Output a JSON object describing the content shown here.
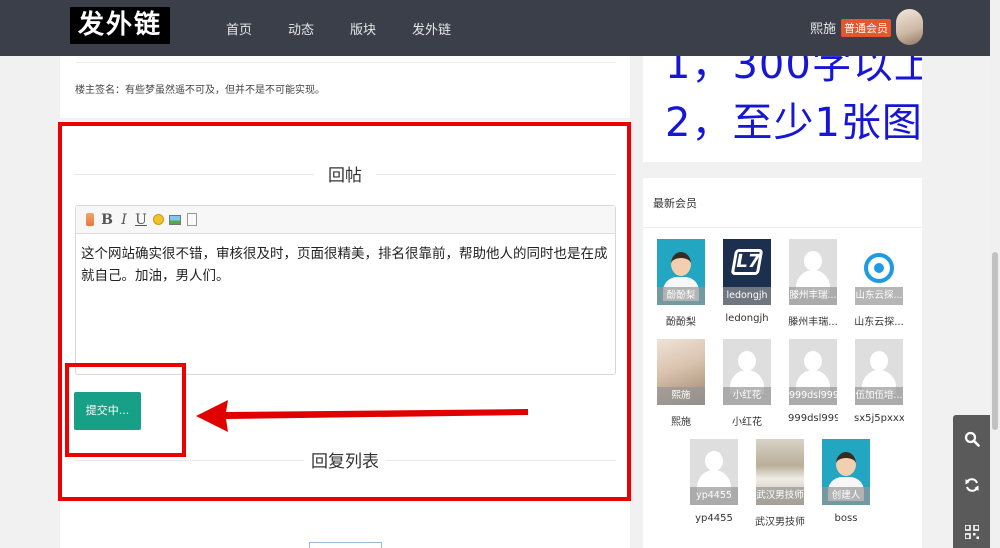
{
  "header": {
    "logo_text": "发外链",
    "nav": [
      "首页",
      "动态",
      "版块",
      "发外链"
    ],
    "user_name": "熙施",
    "vip_badge": "普通会员"
  },
  "post": {
    "signature": "楼主签名：有些梦虽然遥不可及，但并不是不可能实现。"
  },
  "reply": {
    "section_title": "回帖",
    "editor_text": "这个网站确实很不错，审核很及时，页面很精美，排名很靠前，帮助他人的同时也是在成就自己。加油，男人们。",
    "submit_label": "提交中...",
    "reply_list_title": "回复列表"
  },
  "rules": {
    "line1": "1，300字以上",
    "line2": "2，至少1张图"
  },
  "members": {
    "title": "最新会员",
    "items": [
      {
        "overlay": "酚酚梨",
        "name": "酚酚梨",
        "avatar": "male-avatar"
      },
      {
        "overlay": "ledongjh",
        "name": "ledongjh",
        "avatar": "logo-avatar"
      },
      {
        "overlay": "滕州丰瑞...",
        "name": "滕州丰瑞...",
        "avatar": "placeholder-avatar"
      },
      {
        "overlay": "山东云探...",
        "name": "山东云探...",
        "avatar": "brand-avatar"
      },
      {
        "overlay": "熙施",
        "name": "熙施",
        "avatar": "photo-avatar"
      },
      {
        "overlay": "小红花",
        "name": "小红花",
        "avatar": "placeholder-avatar"
      },
      {
        "overlay": "999dsl999",
        "name": "999dsl999",
        "avatar": "placeholder-avatar"
      },
      {
        "overlay": "伍加伍培...",
        "name": "sx5j5pxxx",
        "avatar": "placeholder-avatar"
      },
      {
        "overlay": "yp4455",
        "name": "yp4455",
        "avatar": "placeholder-avatar"
      },
      {
        "overlay": "武汉男技师",
        "name": "武汉男技师",
        "avatar": "room-avatar"
      },
      {
        "overlay": "创建人",
        "name": "boss",
        "avatar": "male-avatar"
      }
    ]
  },
  "side_tools": [
    "search-icon",
    "refresh-icon",
    "qrcode-icon"
  ],
  "colors": {
    "header_bg": "#3b3f4a",
    "accent_green": "#17a085",
    "annotation_red": "#e00000",
    "rules_blue": "#1616d4",
    "vip_orange": "#e4572e"
  }
}
